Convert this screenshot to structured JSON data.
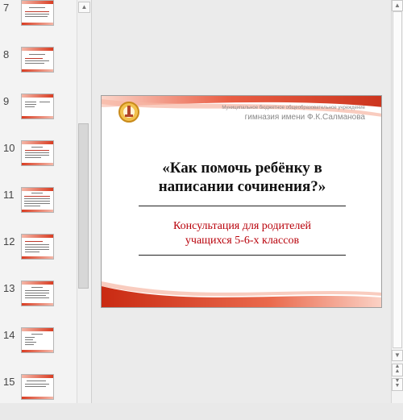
{
  "thumbnails": [
    {
      "number": "7"
    },
    {
      "number": "8"
    },
    {
      "number": "9"
    },
    {
      "number": "10"
    },
    {
      "number": "11"
    },
    {
      "number": "12"
    },
    {
      "number": "13"
    },
    {
      "number": "14"
    },
    {
      "number": "15"
    }
  ],
  "slide": {
    "school_line1": "Муниципальное бюджетное общеобразовательное учреждение",
    "school_line2": "гимназия имени Ф.К.Салманова",
    "title_line1": "«Как помочь ребёнку в",
    "title_line2": "написании сочинения?»",
    "subtitle_line1": "Консультация для родителей",
    "subtitle_line2": "учащихся 5-6-х классов"
  },
  "colors": {
    "accent_red": "#d93c22",
    "subtitle_red": "#b8000a"
  },
  "icons": {
    "scroll_up": "triangle-up",
    "scroll_down": "triangle-down",
    "prev_slide": "double-chevron-up",
    "next_slide": "double-chevron-down"
  }
}
